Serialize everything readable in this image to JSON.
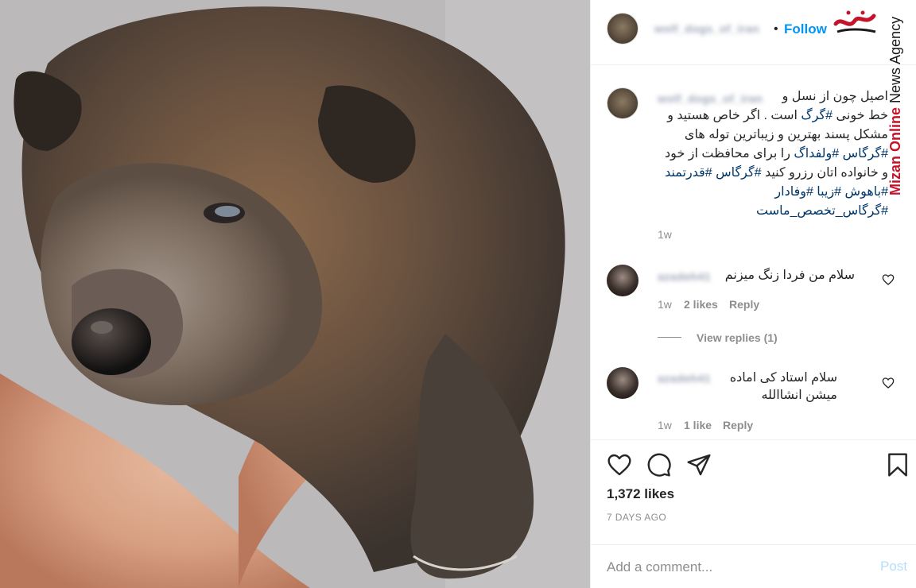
{
  "post": {
    "username": "wolf_dogs_of_iran",
    "follow_label": "Follow",
    "separator": "•",
    "caption_lines": [
      [
        {
          "t": "اصیل چون از نسل و",
          "tag": false
        }
      ],
      [
        {
          "t": "خط خونی ",
          "tag": false
        },
        {
          "t": "#گرگ",
          "tag": true
        },
        {
          "t": " است . اگر خاص هستید و",
          "tag": false
        }
      ],
      [
        {
          "t": "مشکل پسند بهترین و زیباترین توله های",
          "tag": false
        }
      ],
      [
        {
          "t": "#گرگاس",
          "tag": true
        },
        {
          "t": " ",
          "tag": false
        },
        {
          "t": "#ولفداگ",
          "tag": true
        },
        {
          "t": " را برای محافظت از خود",
          "tag": false
        }
      ],
      [
        {
          "t": "و خانواده اتان رزرو کنید ",
          "tag": false
        },
        {
          "t": "#گرگاس",
          "tag": true
        },
        {
          "t": " ",
          "tag": false
        },
        {
          "t": "#قدرتمند",
          "tag": true
        }
      ],
      [
        {
          "t": "#باهوش",
          "tag": true
        },
        {
          "t": " ",
          "tag": false
        },
        {
          "t": "#زیبا",
          "tag": true
        },
        {
          "t": " ",
          "tag": false
        },
        {
          "t": "#وفادار",
          "tag": true
        }
      ],
      [
        {
          "t": "#گرگاس_تخصص_ماست",
          "tag": true
        }
      ]
    ],
    "caption_age": "1w",
    "likes_label": "1,372 likes",
    "posted_ago": "7 DAYS AGO"
  },
  "comments": [
    {
      "username": "azadeh41",
      "lines": [
        "سلام من فردا زنگ میزنم"
      ],
      "age": "1w",
      "likes": "2 likes",
      "reply_label": "Reply",
      "view_replies": "View replies (1)"
    },
    {
      "username": "azadeh41",
      "lines": [
        "سلام استاد کی اماده",
        "میشن انشاالله"
      ],
      "age": "1w",
      "likes": "1 like",
      "reply_label": "Reply"
    }
  ],
  "add_comment": {
    "placeholder": "Add a comment...",
    "post_label": "Post"
  },
  "watermark": {
    "brand": "Mizan Online",
    "rest": " News Agency",
    "logo_text": "میزان",
    "logo_sub": "خبرگزاری"
  },
  "icons": {
    "like": "heart-icon",
    "comment": "comment-bubble-icon",
    "share": "paper-plane-icon",
    "save": "bookmark-icon"
  },
  "colors": {
    "link": "#0095f6",
    "hashtag": "#00376b",
    "muted": "#8e8e8e",
    "brand_red": "#c4142a"
  }
}
